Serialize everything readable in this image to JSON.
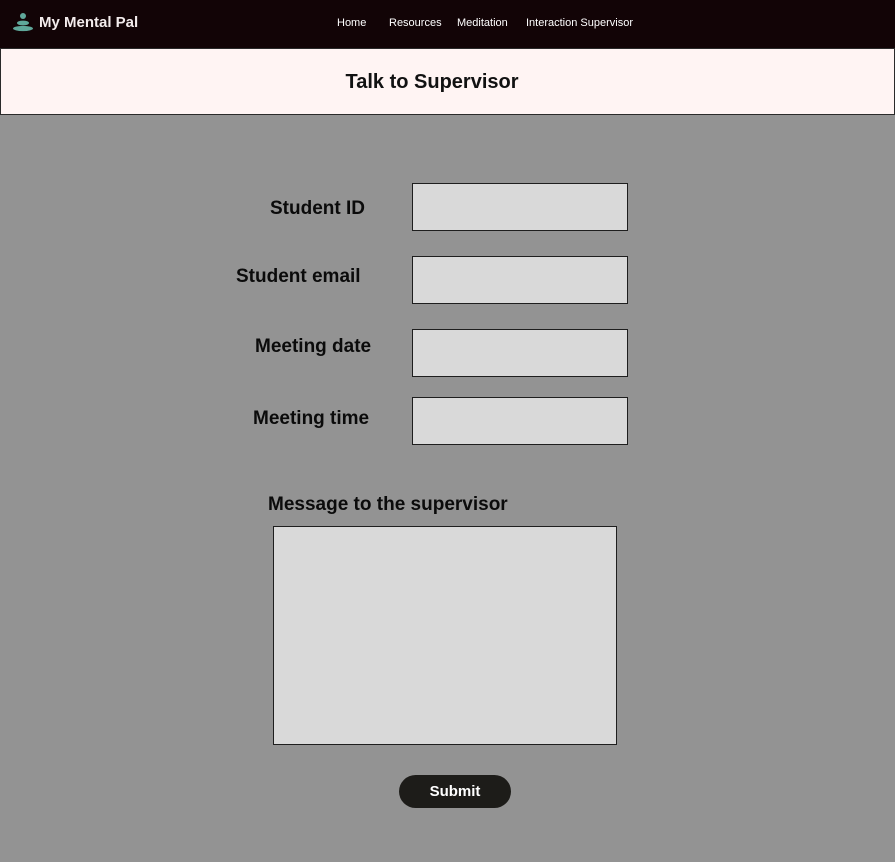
{
  "brand": {
    "name": "My Mental Pal",
    "icon": "stacked-stones-logo-icon",
    "icon_color": "#5fa89a"
  },
  "nav": {
    "items": [
      {
        "label": "Home"
      },
      {
        "label": "Resources"
      },
      {
        "label": "Meditation"
      },
      {
        "label": "Interaction Supervisor"
      }
    ]
  },
  "page": {
    "title": "Talk to Supervisor"
  },
  "form": {
    "student_id_label": "Student ID",
    "student_email_label": "Student email",
    "meeting_date_label": "Meeting date",
    "meeting_time_label": "Meeting time",
    "message_label": "Message to the supervisor",
    "submit_label": "Submit"
  },
  "colors": {
    "navbar": "#120406",
    "title_bar": "#fff4f3",
    "background": "#939393",
    "field": "#d9d9d9",
    "button": "#1d1c19"
  }
}
